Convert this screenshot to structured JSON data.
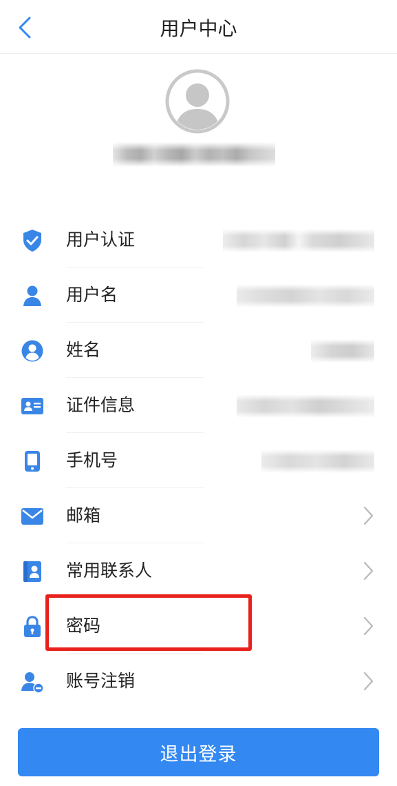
{
  "nav": {
    "title": "用户中心",
    "back_icon": "chevron-left-icon"
  },
  "profile": {
    "avatar_icon": "user-avatar-icon"
  },
  "menu": {
    "items": [
      {
        "label": "用户认证",
        "icon": "shield-check-icon",
        "has_chevron": false
      },
      {
        "label": "用户名",
        "icon": "person-icon",
        "has_chevron": false
      },
      {
        "label": "姓名",
        "icon": "person-circle-icon",
        "has_chevron": false
      },
      {
        "label": "证件信息",
        "icon": "id-card-icon",
        "has_chevron": false
      },
      {
        "label": "手机号",
        "icon": "phone-icon",
        "has_chevron": false
      },
      {
        "label": "邮箱",
        "icon": "mail-icon",
        "has_chevron": true
      },
      {
        "label": "常用联系人",
        "icon": "contacts-book-icon",
        "has_chevron": true
      },
      {
        "label": "密码",
        "icon": "lock-icon",
        "has_chevron": true
      },
      {
        "label": "账号注销",
        "icon": "user-remove-icon",
        "has_chevron": true
      }
    ]
  },
  "logout": {
    "label": "退出登录"
  },
  "colors": {
    "accent": "#3388f2",
    "icon_blue": "#3a86e6",
    "highlight_red": "#e8211c",
    "chevron_gray": "#b8b8b8"
  }
}
